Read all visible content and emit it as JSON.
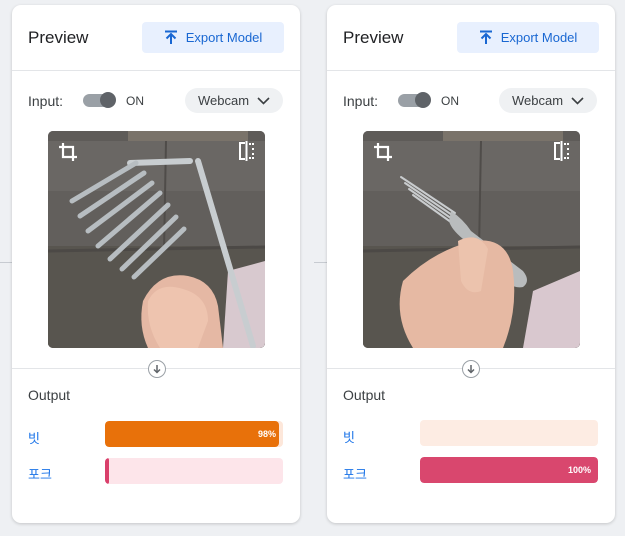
{
  "panels": [
    {
      "header": {
        "title": "Preview",
        "export_label": "Export Model"
      },
      "input": {
        "label": "Input:",
        "toggle_state": "ON",
        "source": "Webcam"
      },
      "output": {
        "title": "Output",
        "classes": [
          {
            "label": "빗",
            "percent_text": "98%",
            "confidence": 0.98,
            "color": "#e8710a",
            "track": "#fde7da"
          },
          {
            "label": "포크",
            "percent_text": "",
            "confidence": 0.02,
            "color": "#d93f6b",
            "track": "#fde5ea"
          }
        ]
      }
    },
    {
      "header": {
        "title": "Preview",
        "export_label": "Export Model"
      },
      "input": {
        "label": "Input:",
        "toggle_state": "ON",
        "source": "Webcam"
      },
      "output": {
        "title": "Output",
        "classes": [
          {
            "label": "빗",
            "percent_text": "",
            "confidence": 0.0,
            "color": "#e8710a",
            "track": "#fdece3"
          },
          {
            "label": "포크",
            "percent_text": "100%",
            "confidence": 1.0,
            "color": "#d9476e",
            "track": "#fde5ea"
          }
        ]
      }
    }
  ],
  "icons": {
    "export": "upload-arrow-icon",
    "dropdown": "chevron-down-icon",
    "crop": "crop-icon",
    "flip": "flip-horizontal-icon",
    "arrow": "arrow-down-icon"
  }
}
